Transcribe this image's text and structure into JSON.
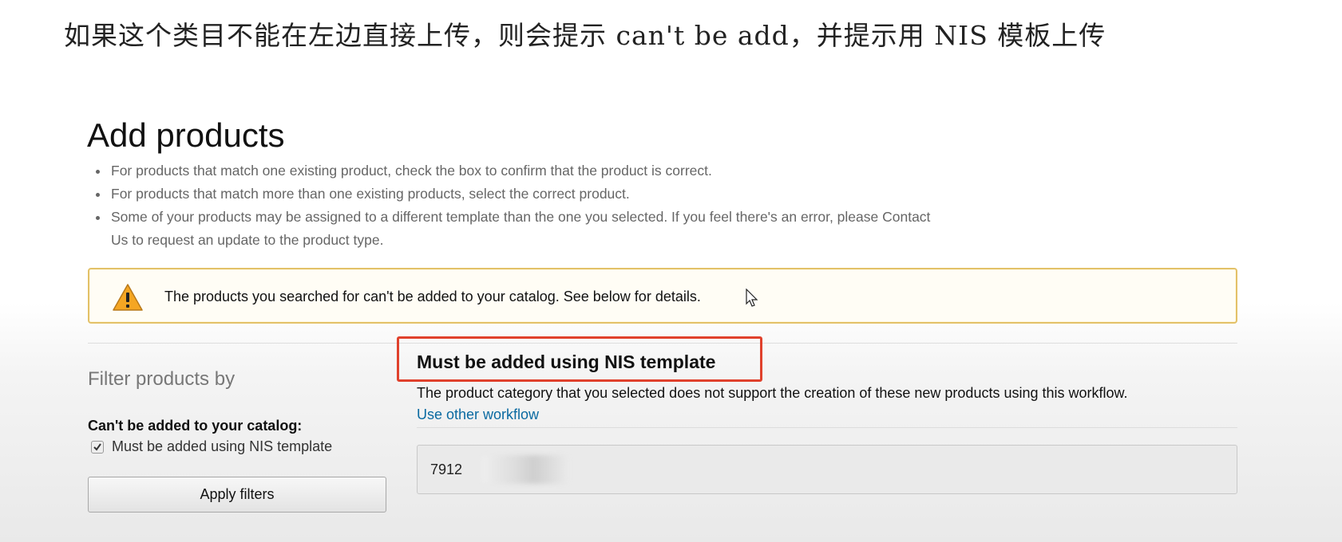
{
  "caption": "如果这个类目不能在左边直接上传，则会提示  can't be add，并提示用 NIS 模板上传",
  "page": {
    "title": "Add products",
    "bullets": [
      "For products that match one existing product, check the box to confirm that the product is correct.",
      "For products that match more than one existing products, select the correct product.",
      "Some of your products may be assigned to a different template than the one you selected. If you feel there's an error, please Contact Us to request an update to the product type."
    ]
  },
  "alert": {
    "icon": "warning-triangle-icon",
    "text": "The products you searched for can't be added to your catalog. See below for details.",
    "border_color": "#e3c168"
  },
  "filters": {
    "heading": "Filter products by",
    "group_label": "Can't be added to your catalog:",
    "options": [
      {
        "label": "Must be added using NIS template",
        "checked": true
      }
    ],
    "apply_label": "Apply filters"
  },
  "result": {
    "title": "Must be added using NIS template",
    "description": "The product category that you selected does not support the creation of these new products using this workflow.",
    "link": "Use other workflow",
    "link_color": "#0a6aa1",
    "highlight_color": "#e0412c",
    "product_id": "7912"
  }
}
